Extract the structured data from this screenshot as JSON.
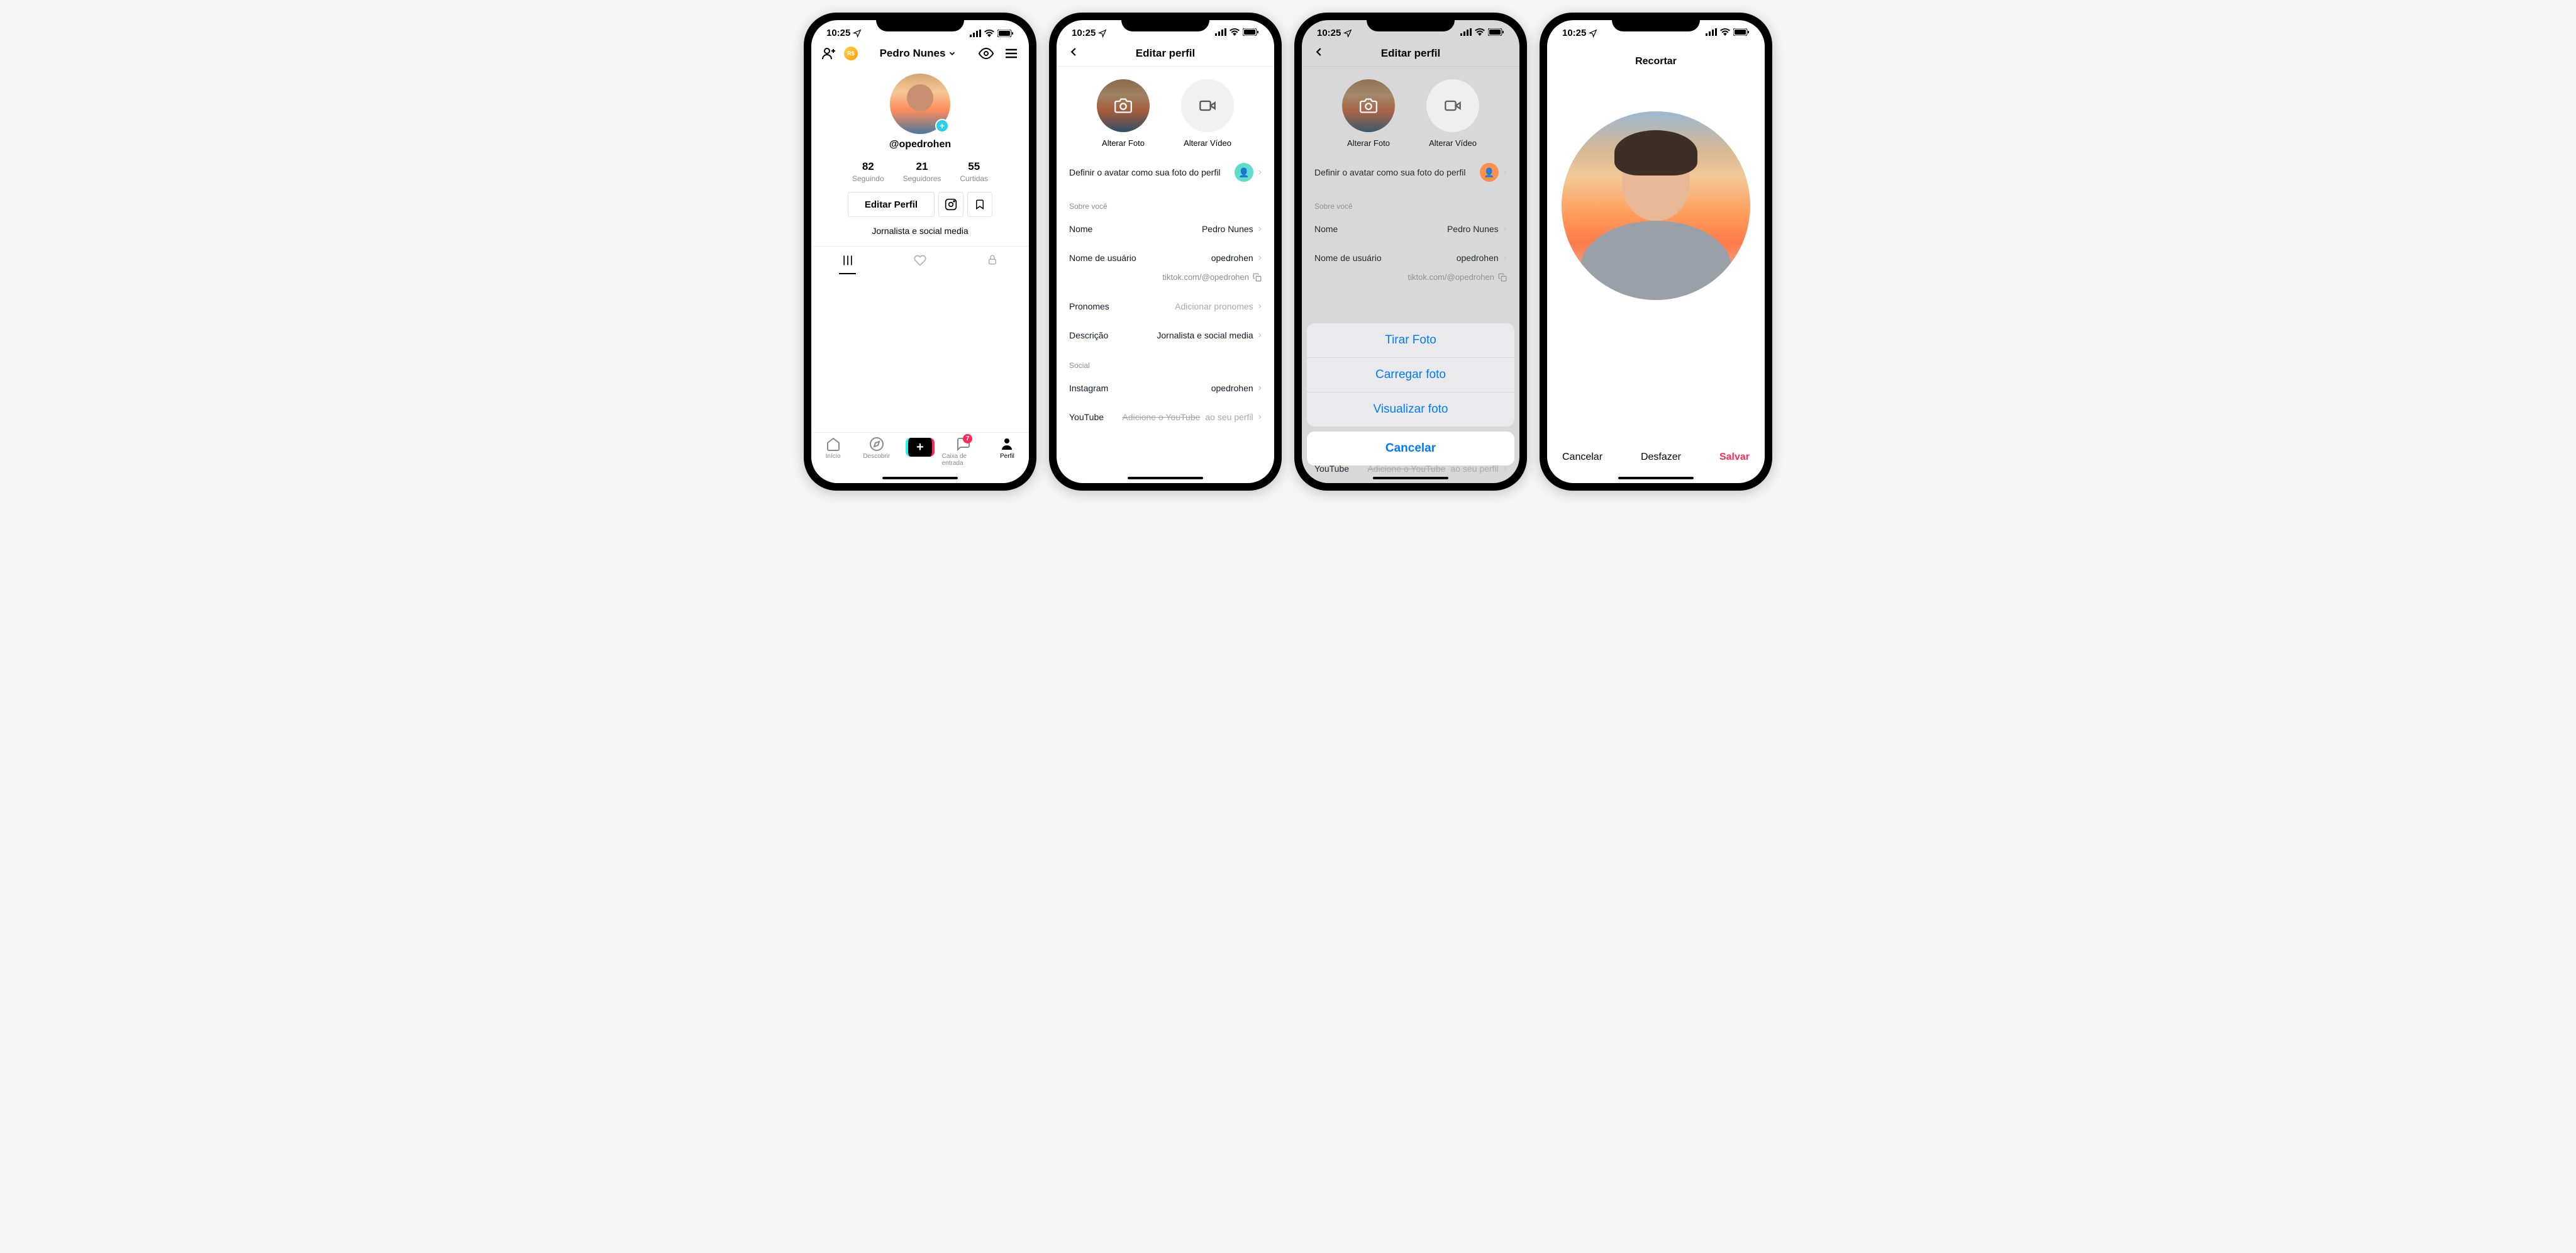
{
  "status": {
    "time": "10:25"
  },
  "screen1": {
    "title": "Pedro Nunes",
    "username": "@opedrohen",
    "stats": {
      "following_num": "82",
      "following_label": "Seguindo",
      "followers_num": "21",
      "followers_label": "Seguidores",
      "likes_num": "55",
      "likes_label": "Curtidas"
    },
    "edit_button": "Editar Perfil",
    "bio": "Jornalista e social media",
    "nav": {
      "home": "Início",
      "discover": "Descobrir",
      "create": "Criar",
      "inbox": "Caixa de entrada",
      "profile": "Perfil",
      "inbox_badge": "7"
    }
  },
  "screen2": {
    "title": "Editar perfil",
    "change_photo": "Alterar Foto",
    "change_video": "Alterar Vídeo",
    "avatar_row": "Definir o avatar como sua foto do perfil",
    "about_section": "Sobre você",
    "name_label": "Nome",
    "name_value": "Pedro Nunes",
    "username_label": "Nome de usuário",
    "username_value": "opedrohen",
    "url": "tiktok.com/@opedrohen",
    "pronouns_label": "Pronomes",
    "pronouns_value": "Adicionar pronomes",
    "desc_label": "Descrição",
    "desc_value": "Jornalista e social media",
    "social_section": "Social",
    "instagram_label": "Instagram",
    "instagram_value": "opedrohen",
    "youtube_label": "YouTube",
    "youtube_prefix": "Adicione o YouTube",
    "youtube_suffix": " ao seu perfil"
  },
  "screen3": {
    "sheet": {
      "take": "Tirar Foto",
      "upload": "Carregar foto",
      "view": "Visualizar foto",
      "cancel": "Cancelar"
    }
  },
  "screen4": {
    "title": "Recortar",
    "cancel": "Cancelar",
    "undo": "Desfazer",
    "save": "Salvar"
  }
}
